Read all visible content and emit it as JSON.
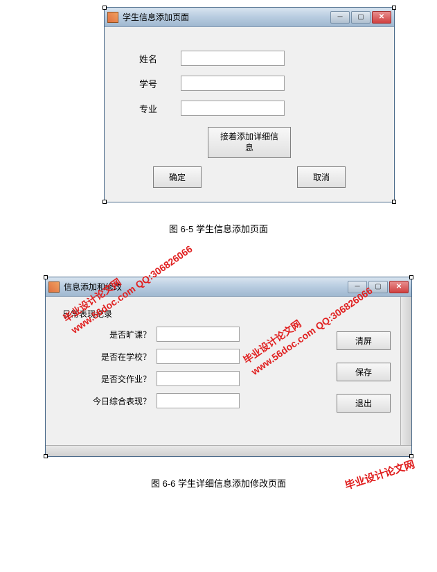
{
  "window1": {
    "title": "学生信息添加页面",
    "fields": {
      "name_label": "姓名",
      "id_label": "学号",
      "major_label": "专业",
      "name_value": "",
      "id_value": "",
      "major_value": ""
    },
    "buttons": {
      "add_detail": "接着添加详细信息",
      "ok": "确定",
      "cancel": "取消"
    }
  },
  "caption1": "图 6-5 学生信息添加页面",
  "window2": {
    "title": "信息添加和修改",
    "section_title": "日常表现记录",
    "fields": {
      "absent_label": "是否旷课？",
      "at_school_label": "是否在学校？",
      "homework_label": "是否交作业？",
      "performance_label": "今日综合表现？",
      "absent_value": "",
      "at_school_value": "",
      "homework_value": "",
      "performance_value": ""
    },
    "buttons": {
      "clear": "清屏",
      "save": "保存",
      "exit": "退出"
    }
  },
  "caption2": "图 6-6 学生详细信息添加修改页面",
  "watermark": {
    "line1": "毕业设计论文网",
    "line2": "www.56doc.com  QQ:306826066"
  }
}
